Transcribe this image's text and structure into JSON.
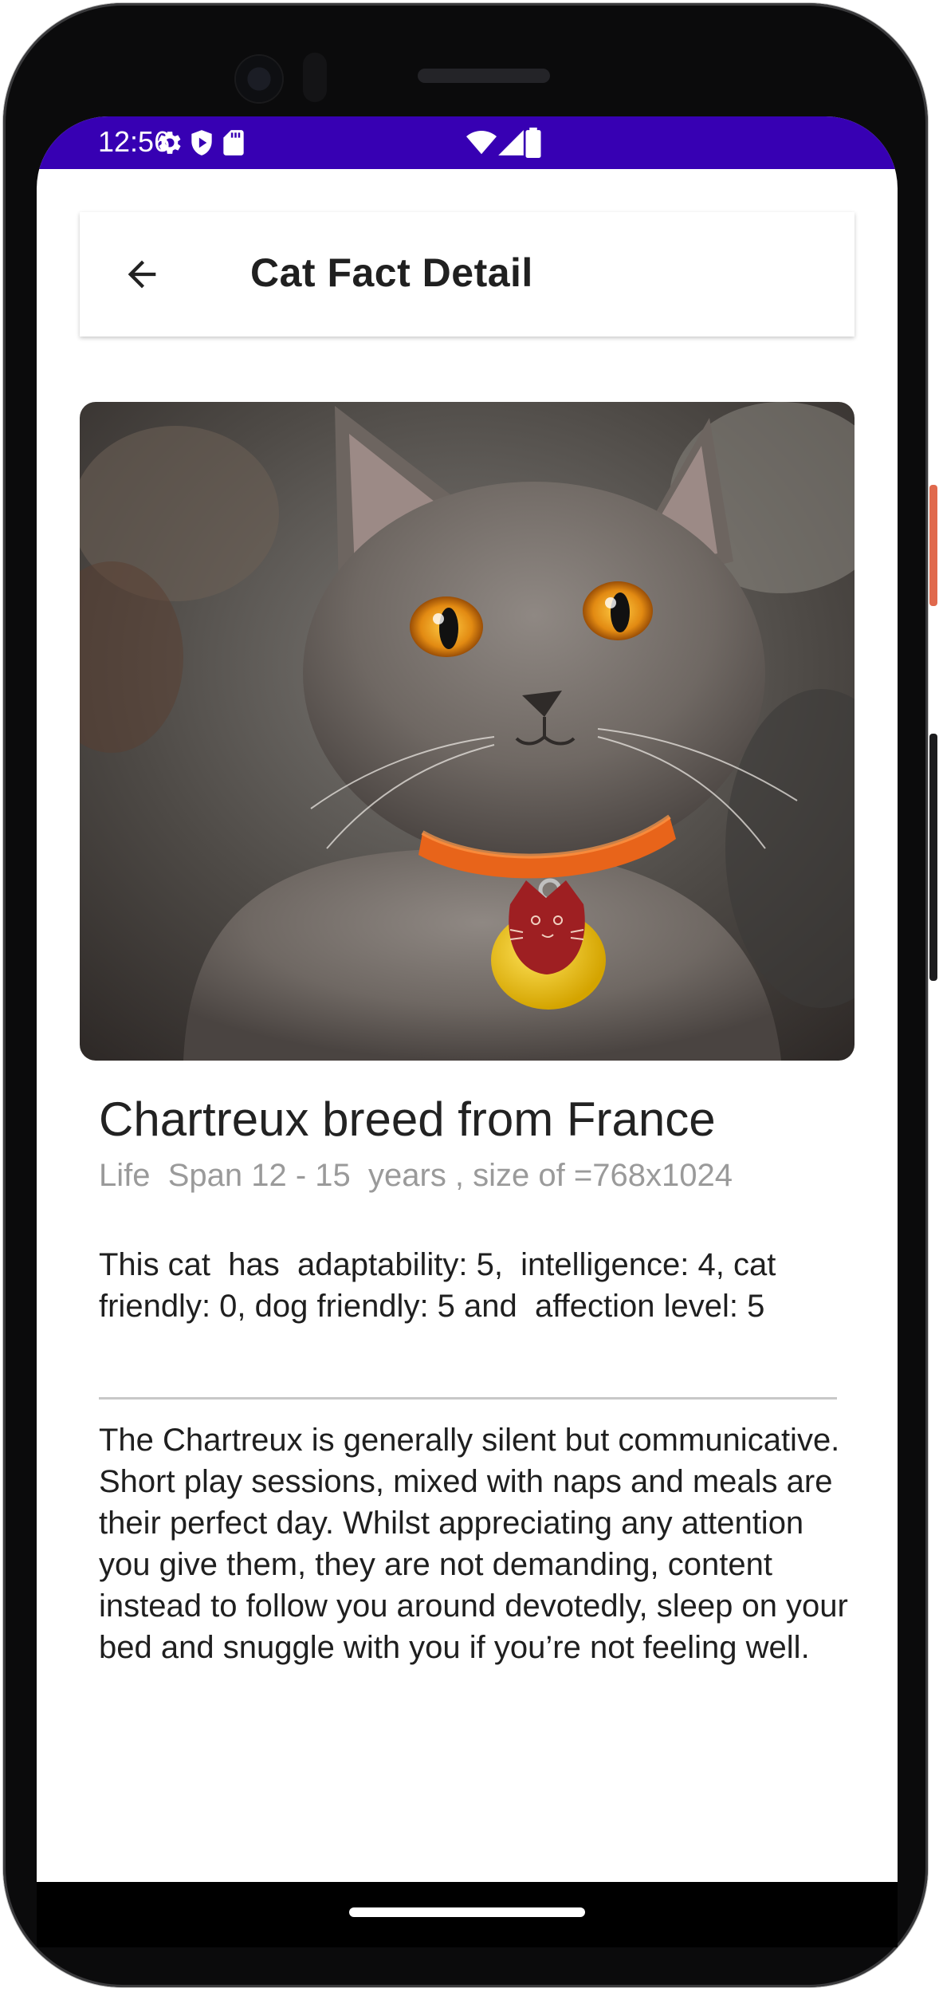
{
  "status_bar": {
    "time": "12:56",
    "background": "#3700b3",
    "left_icons": [
      "gear-icon",
      "shield-play-icon",
      "sd-card-icon"
    ],
    "right_icons": [
      "wifi-icon",
      "signal-icon",
      "battery-icon"
    ]
  },
  "app_bar": {
    "title": "Cat Fact Detail",
    "back_icon": "arrow-left-icon"
  },
  "breed": {
    "title": "Chartreux breed from France",
    "subtitle": "Life  Span 12 - 15  years , size of =768x1024",
    "stats": "This cat  has  adaptability: 5,  intelligence: 4, cat friendly: 0, dog friendly: 5 and  affection level: 5",
    "description": "The Chartreux is generally silent but communicative. Short play sessions, mixed with naps and meals are their perfect day. Whilst appreciating any attention you give them, they are not demanding, content instead to follow you around devotedly, sleep on your bed and snuggle with you if you’re not feeling well."
  },
  "colors": {
    "status_bar": "#3700b3",
    "title_text": "#222222",
    "subtitle_text": "#9a9a9a",
    "divider": "#c8c8c8"
  }
}
